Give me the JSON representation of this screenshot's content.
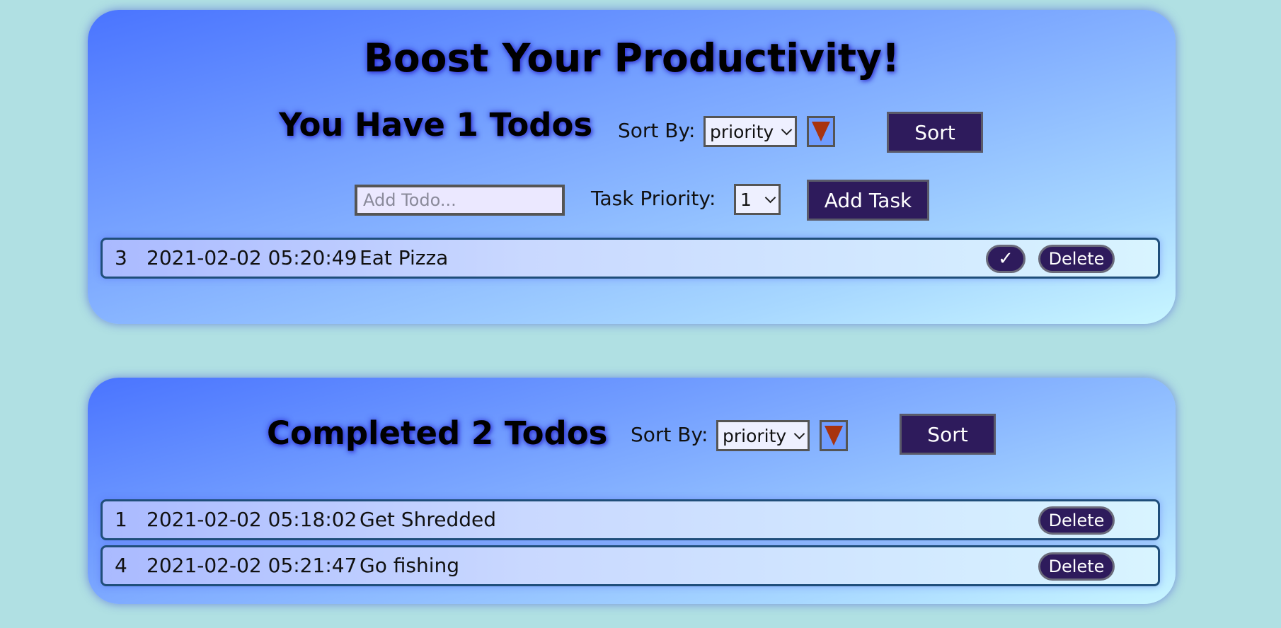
{
  "header": {
    "title": "Boost Your Productivity!"
  },
  "todos": {
    "heading": "You Have 1 Todos",
    "sort_by_label": "Sort By:",
    "sort_select_value": "priority",
    "sort_direction_icon": "triangle-down-icon",
    "sort_button_label": "Sort",
    "add_input_placeholder": "Add Todo...",
    "add_input_value": "",
    "task_priority_label": "Task Priority:",
    "task_priority_value": "1",
    "add_button_label": "Add Task",
    "items": [
      {
        "id": "3",
        "date": "2021-02-02 05:20:49",
        "text": "Eat Pizza",
        "complete_label": "✓",
        "delete_label": "Delete"
      }
    ]
  },
  "completed": {
    "heading": "Completed 2 Todos",
    "sort_by_label": "Sort By:",
    "sort_select_value": "priority",
    "sort_direction_icon": "triangle-down-icon",
    "sort_button_label": "Sort",
    "items": [
      {
        "id": "1",
        "date": "2021-02-02 05:18:02",
        "text": "Get Shredded",
        "delete_label": "Delete"
      },
      {
        "id": "4",
        "date": "2021-02-02 05:21:47",
        "text": "Go fishing",
        "delete_label": "Delete"
      }
    ]
  },
  "colors": {
    "page_background": "#b0e0e3",
    "button_background": "#2e1b5c",
    "sort_arrow": "#a8330f",
    "row_border": "#1f4e7a"
  }
}
